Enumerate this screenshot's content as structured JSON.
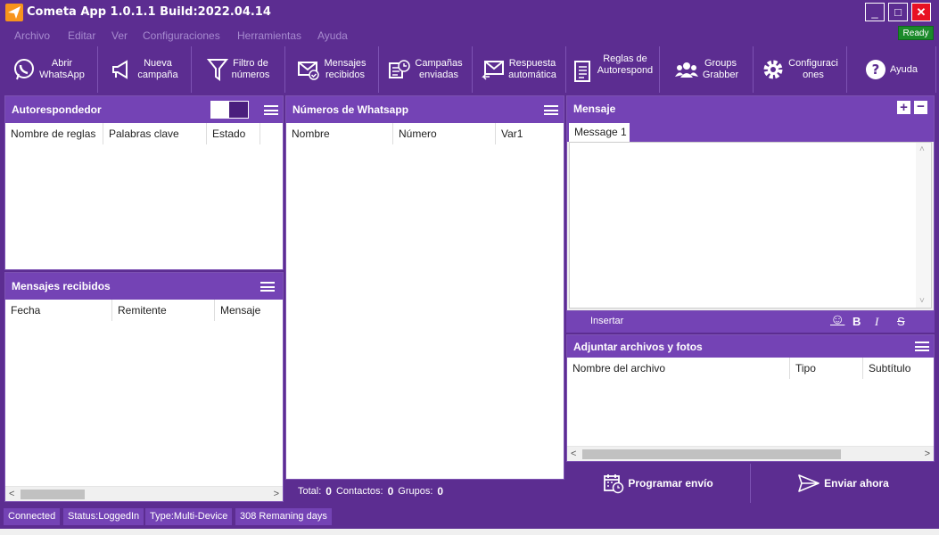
{
  "window": {
    "title": "Cometa App  1.0.1.1 Build:2022.04.14",
    "minimize": "_",
    "maximize": "□",
    "close": "✕"
  },
  "menu": [
    "Archivo",
    "Editar",
    "Ver",
    "Configuraciones",
    "Herramientas",
    "Ayuda"
  ],
  "ready_badge": "Ready",
  "toolbar": [
    {
      "label": "Abrir\nWhatsApp",
      "icon": "whatsapp-icon"
    },
    {
      "label": "Nueva\ncampaña",
      "icon": "megaphone-icon"
    },
    {
      "label": "Filtro de\nnúmeros",
      "icon": "filter-icon"
    },
    {
      "label": "Mensajes\nrecibidos",
      "icon": "envelope-check-icon"
    },
    {
      "label": "Campañas\nenviadas",
      "icon": "sent-campaigns-icon"
    },
    {
      "label": "Respuesta\nautomática",
      "icon": "reply-envelope-icon"
    },
    {
      "label": "Reglas de\nAutorespond",
      "icon": "rules-icon"
    },
    {
      "label": "Groups\nGrabber",
      "icon": "group-icon"
    },
    {
      "label": "Configuraci\nones",
      "icon": "gear-icon"
    },
    {
      "label": "Ayuda",
      "icon": "help-icon"
    }
  ],
  "autoresponder": {
    "title": "Autorespondedor",
    "columns": [
      "Nombre de reglas",
      "Palabras clave",
      "Estado"
    ]
  },
  "received": {
    "title": "Mensajes recibidos",
    "columns": [
      "Fecha",
      "Remitente",
      "Mensaje"
    ]
  },
  "numbers": {
    "title": "Números de Whatsapp",
    "columns": [
      "Nombre",
      "Número",
      "Var1"
    ],
    "footer": {
      "total_label": "Total:",
      "total": "0",
      "contacts_label": "Contactos:",
      "contacts": "0",
      "groups_label": "Grupos:",
      "groups": "0"
    }
  },
  "message": {
    "title": "Mensaje",
    "add": "+",
    "remove": "−",
    "tab": "Message 1",
    "insert_label": "Insertar",
    "emoji": "☺",
    "bold": "B",
    "italic": "I",
    "strike": "S"
  },
  "attachments": {
    "title": "Adjuntar archivos y fotos",
    "columns": [
      "Nombre del archivo",
      "Tipo",
      "Subtítulo"
    ]
  },
  "actions": {
    "schedule": "Programar envío",
    "send_now": "Enviar ahora"
  },
  "statusbar": [
    "Connected",
    "Status:LoggedIn",
    "Type:Multi-Device",
    "308 Remaning days"
  ],
  "colors": {
    "primary": "#5c2d91",
    "header": "#7443b5",
    "ready": "#1b8a2a",
    "close": "#e81123"
  }
}
